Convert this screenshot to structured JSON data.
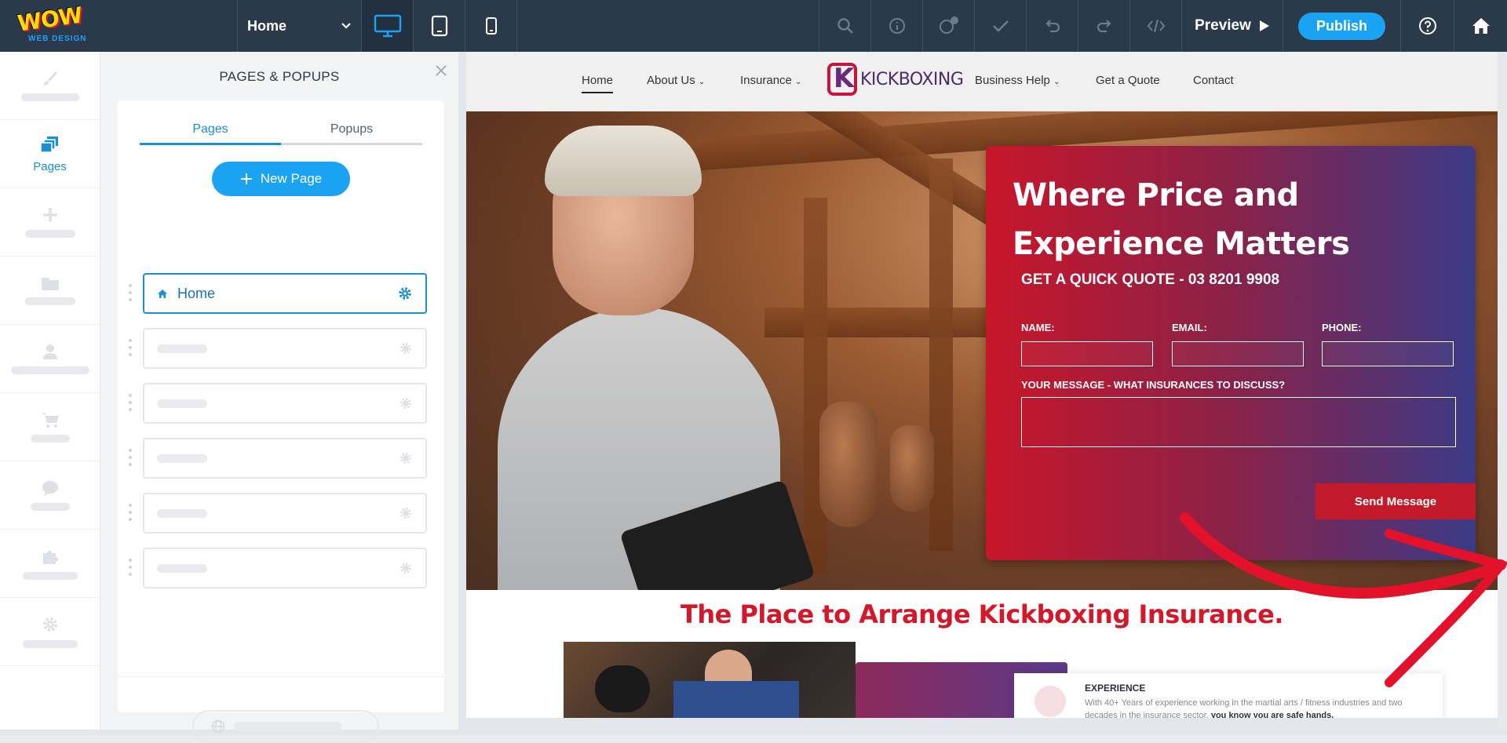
{
  "topbar": {
    "page_selector": "Home",
    "preview_label": "Preview",
    "publish_label": "Publish"
  },
  "rail": {
    "pages_label": "Pages"
  },
  "panel": {
    "title": "PAGES & POPUPS",
    "tabs": [
      "Pages",
      "Popups"
    ],
    "new_page_label": "New Page",
    "pages": [
      {
        "label": "Home"
      }
    ]
  },
  "site": {
    "nav": {
      "home": "Home",
      "about": "About Us",
      "insurance": "Insurance",
      "brand": "KICKBOXING",
      "business": "Business Help",
      "quote": "Get a Quote",
      "contact": "Contact"
    },
    "hero": {
      "headline_1": "Where Price and",
      "headline_2": "Experience Matters",
      "quick_quote": "GET A QUICK QUOTE - 03 8201 9908",
      "name_label": "NAME:",
      "email_label": "EMAIL:",
      "phone_label": "PHONE:",
      "message_label": "YOUR MESSAGE - WHAT INSURANCES TO DISCUSS?",
      "send_label": "Send Message"
    },
    "tagline": "The Place to Arrange Kickboxing Insurance.",
    "experience": {
      "title": "EXPERIENCE",
      "text": "With 40+ Years of experience working in the martial arts / fitness industries and two decades in the insurance sector,",
      "text_bold": "you know you are safe hands."
    }
  },
  "colors": {
    "topbar": "#2b3a4a",
    "accent": "#1aa3f3",
    "brand_red": "#d3182a",
    "form_gradient_start": "#c8162a",
    "form_gradient_end": "#3c3a86"
  }
}
